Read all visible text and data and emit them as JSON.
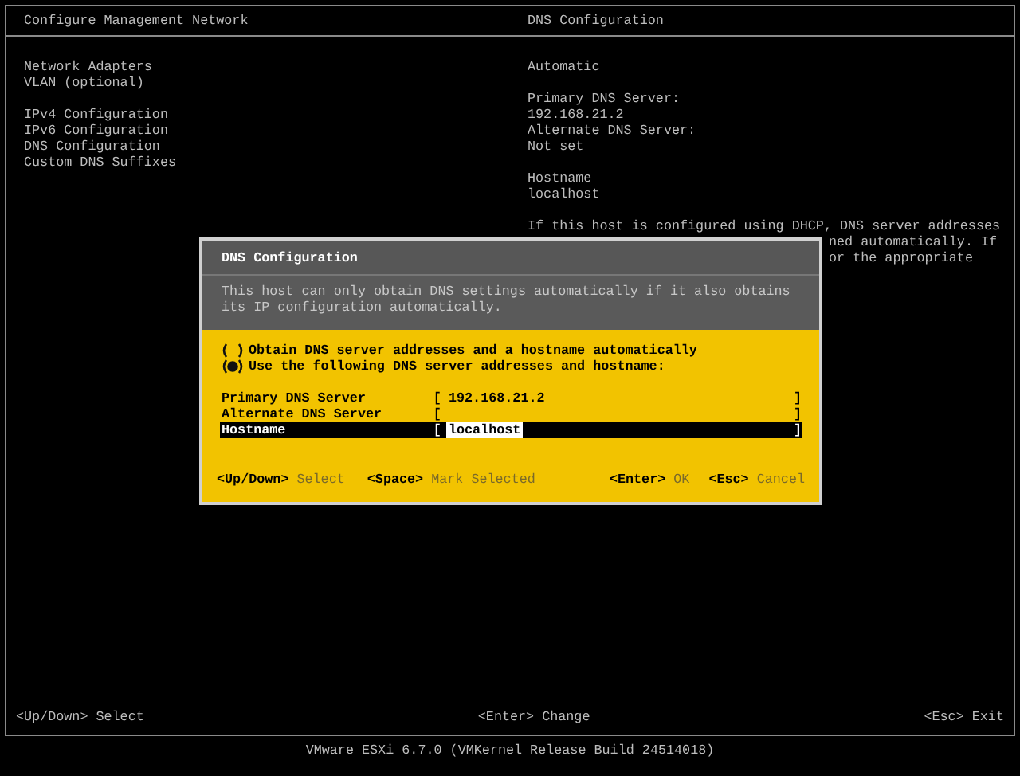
{
  "header": {
    "left_title": "Configure Management Network",
    "right_title": "DNS Configuration"
  },
  "menu_groups": [
    {
      "items": [
        "Network Adapters",
        "VLAN (optional)"
      ]
    },
    {
      "items": [
        "IPv4 Configuration",
        "IPv6 Configuration",
        "DNS Configuration",
        "Custom DNS Suffixes"
      ]
    }
  ],
  "details": [
    {
      "lines": [
        "Automatic"
      ]
    },
    {
      "lines": [
        "Primary DNS Server:",
        "192.168.21.2",
        "Alternate DNS Server:",
        "Not set"
      ]
    },
    {
      "lines": [
        "Hostname",
        "localhost"
      ]
    }
  ],
  "description": {
    "first_line": "If this host is configured using DHCP, DNS server addresses",
    "visible_fragments": [
      "ned automatically. If",
      "or the appropriate"
    ]
  },
  "dialog": {
    "title": "DNS Configuration",
    "message": "This host can only obtain DNS settings automatically if it also obtains its IP configuration automatically.",
    "options": [
      {
        "label": "Obtain DNS server addresses and a hostname automatically",
        "selected": false
      },
      {
        "label": "Use the following DNS server addresses and hostname:",
        "selected": true
      }
    ],
    "fields": [
      {
        "label": "Primary DNS Server",
        "open": "[",
        "value": "192.168.21.2",
        "close": "]",
        "selected": false
      },
      {
        "label": "Alternate DNS Server",
        "open": "[",
        "close": "]",
        "selected": false
      },
      {
        "label": "Hostname",
        "open": "[",
        "value": "localhost",
        "close": "]",
        "selected": true
      }
    ],
    "hints_left": [
      {
        "key": "<Up/Down>",
        "action": "Select"
      },
      {
        "key": "<Space>",
        "action": "Mark Selected"
      }
    ],
    "hints_right": [
      {
        "key": "<Enter>",
        "action": "OK"
      },
      {
        "key": "<Esc>",
        "action": "Cancel"
      }
    ]
  },
  "footer": [
    {
      "key": "<Up/Down>",
      "action": "Select"
    },
    {
      "key": "<Enter>",
      "action": "Change"
    },
    {
      "key": "<Esc>",
      "action": "Exit"
    }
  ],
  "version": "VMware ESXi 6.7.0 (VMKernel Release Build 24514018)"
}
